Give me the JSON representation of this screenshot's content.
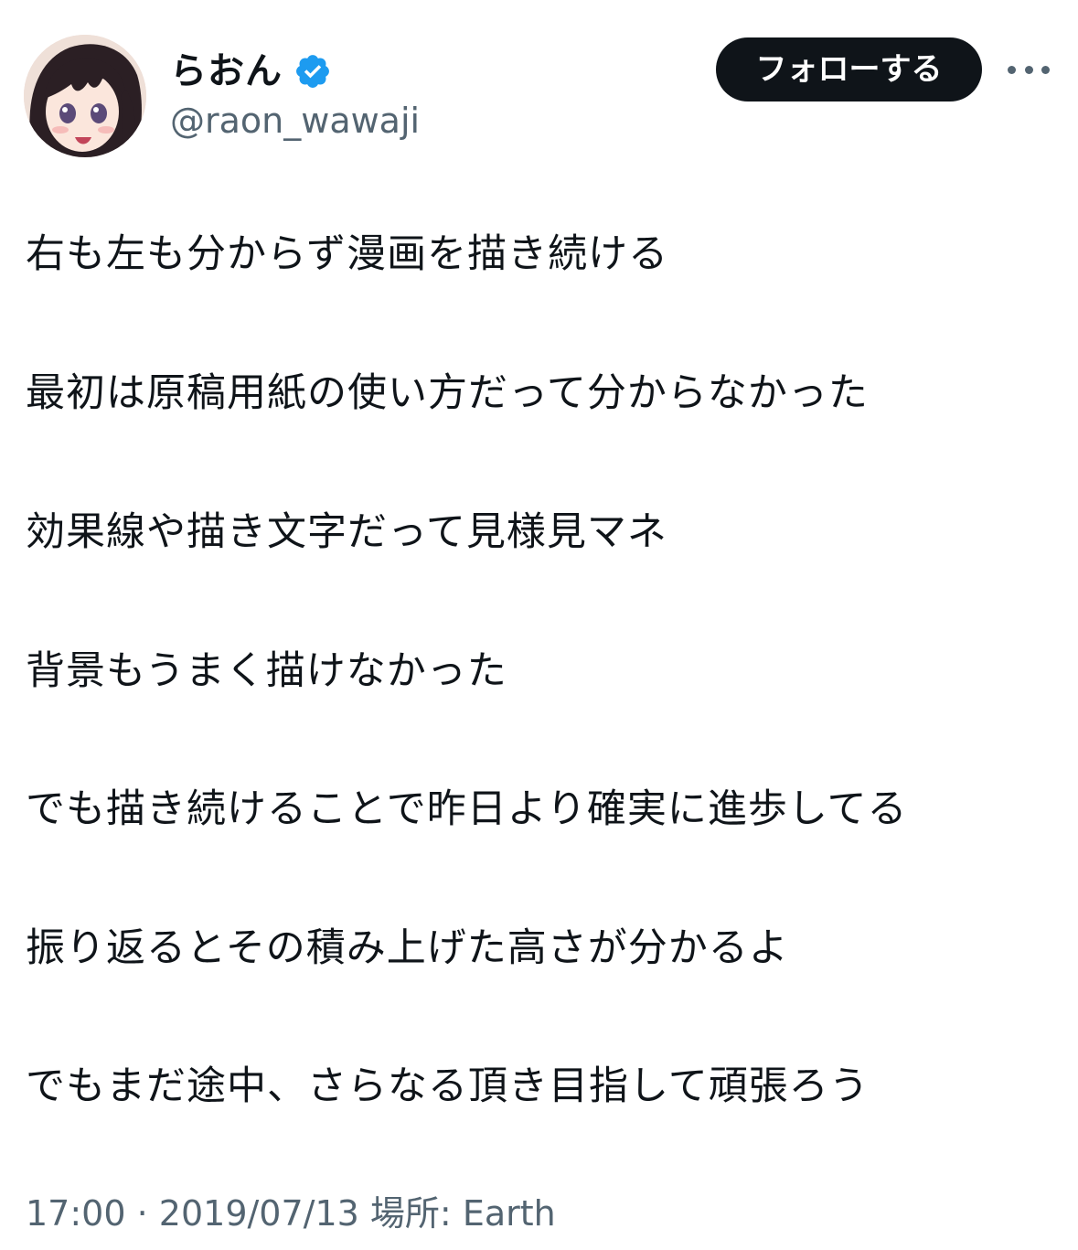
{
  "author": {
    "display_name": "らおん",
    "handle": "@raon_wawaji",
    "verified": true,
    "avatar_icon": "avatar-illustration-girl"
  },
  "actions": {
    "follow_label": "フォローする",
    "more_icon": "more-horizontal-icon"
  },
  "tweet": {
    "lines": [
      "右も左も分からず漫画を描き続ける",
      "最初は原稿用紙の使い方だって分からなかった",
      "効果線や描き文字だって見様見マネ",
      "背景もうまく描けなかった",
      "でも描き続けることで昨日より確実に進歩してる",
      "振り返るとその積み上げた高さが分かるよ",
      "でもまだ途中、さらなる頂き目指して頑張ろう"
    ]
  },
  "meta": {
    "time": "17:00",
    "separator": "·",
    "date": "2019/07/13",
    "location_label": "場所:",
    "location": "Earth"
  },
  "colors": {
    "text": "#0f1419",
    "secondary": "#536471",
    "verified": "#1d9bf0",
    "button_bg": "#0f1419"
  }
}
